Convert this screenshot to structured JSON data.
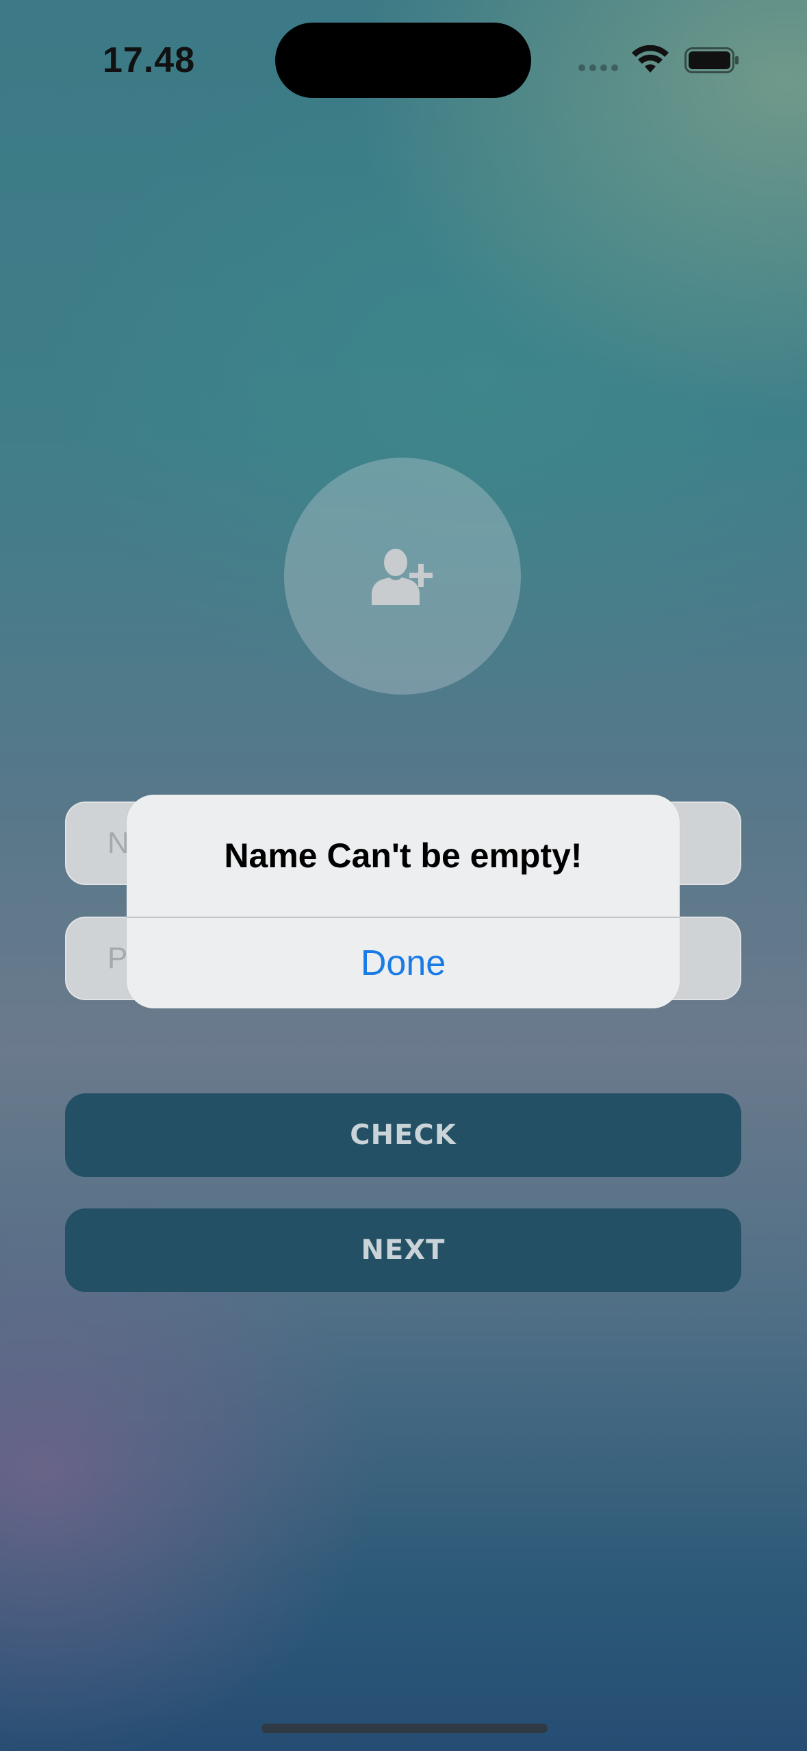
{
  "status_bar": {
    "time": "17.48",
    "icons": [
      "signal-icon",
      "wifi-icon",
      "battery-icon"
    ]
  },
  "avatar": {
    "icon": "add-user-icon"
  },
  "form": {
    "name_placeholder": "N",
    "password_placeholder": "P"
  },
  "buttons": {
    "check_label": "CHECK",
    "next_label": "NEXT"
  },
  "alert": {
    "title": "Name Can't be empty!",
    "done_label": "Done"
  },
  "colors": {
    "button_bg": "#235064",
    "alert_action": "#1a7be6"
  }
}
